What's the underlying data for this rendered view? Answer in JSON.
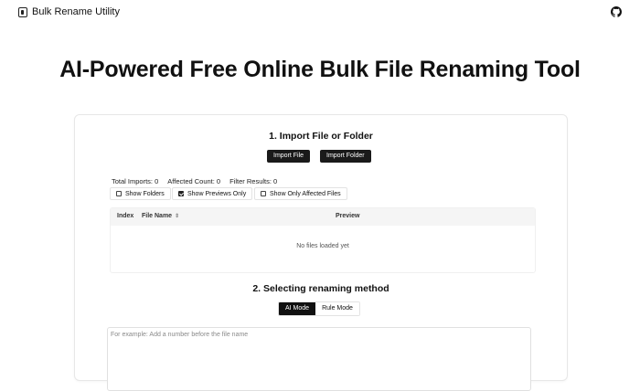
{
  "brand": {
    "name": "Bulk Rename Utility",
    "logo_icon": "file-rename-icon"
  },
  "header": {
    "github_icon": "github-icon"
  },
  "hero": {
    "title": "AI-Powered Free Online Bulk File Renaming Tool"
  },
  "import": {
    "title": "1. Import File or Folder",
    "import_file_label": "Import File",
    "import_folder_label": "Import Folder"
  },
  "stats": {
    "total_imports": "Total Imports: 0",
    "affected_count": "Affected Count: 0",
    "filter_results": "Filter Results: 0"
  },
  "filters": {
    "show_folders": {
      "label": "Show Folders",
      "checked": false
    },
    "show_previews_only": {
      "label": "Show Previews Only",
      "checked": true
    },
    "show_only_affected": {
      "label": "Show Only Affected Files",
      "checked": false
    }
  },
  "table": {
    "columns": [
      "Index",
      "File Name",
      "Preview"
    ],
    "sort_icon": "sort-icon",
    "empty_text": "No files loaded yet"
  },
  "method": {
    "title": "2. Selecting renaming method",
    "ai_mode_label": "AI Mode",
    "rule_mode_label": "Rule Mode",
    "active": "AI Mode"
  },
  "prompt": {
    "placeholder": "For example: Add a number before the file name"
  }
}
